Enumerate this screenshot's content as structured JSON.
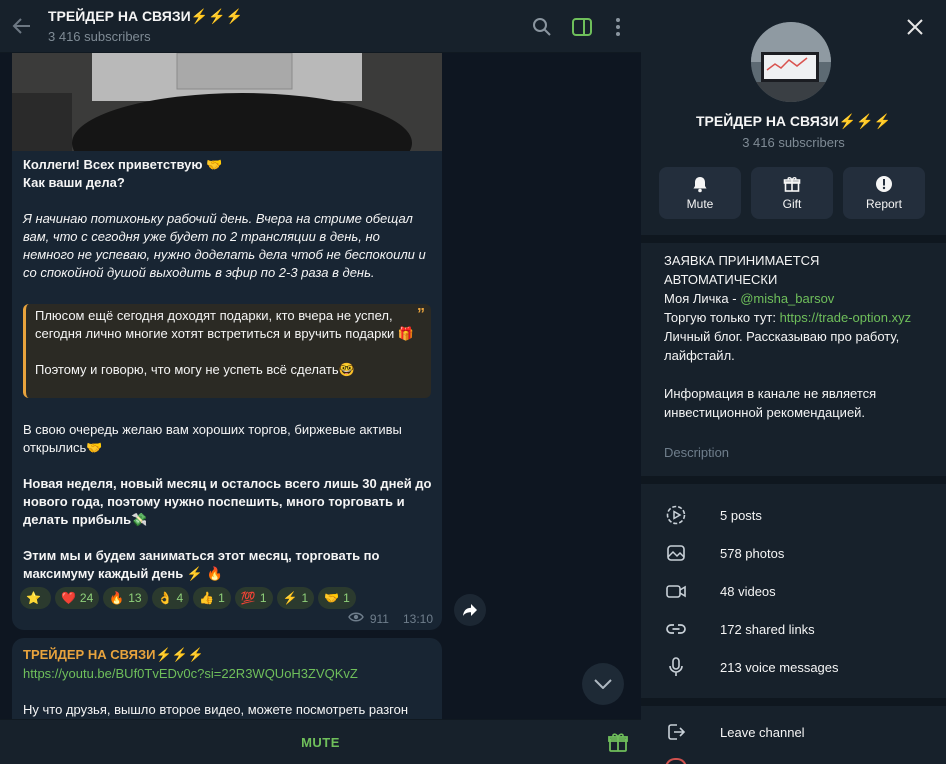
{
  "header": {
    "title": "ТРЕЙДЕР НА СВЯЗИ⚡️⚡️⚡️",
    "subscribers": "3 416 subscribers"
  },
  "message1": {
    "greeting": "Коллеги! Всех приветствую 🤝\nКак ваши дела?",
    "italic": "Я начинаю потихоньку рабочий день. Вчера на стриме обещал вам, что с сегодня уже будет по 2 трансляции в день, но немного не успеваю, нужно доделать дела чтоб не беспокоили и со спокойной душой выходить в эфир по 2-3 раза в день.",
    "quote": "Плюсом ещё сегодня доходят подарки, кто вчера не успел, сегодня лично многие хотят встретиться и вручить подарки 🎁\n\nПоэтому и говорю, что могу не успеть всё сделать🤓",
    "para1": "В свою очередь желаю вам хороших торгов, биржевые активы открылись🤝",
    "para2": "Новая неделя, новый месяц и осталось всего лишь 30 дней до нового года, поэтому нужно поспешить, много торговать и делать прибыль💸",
    "para3": "Этим мы и будем заниматься этот месяц, торговать по максимуму каждый день ⚡️ 🔥",
    "reactions": [
      {
        "emoji": "⭐",
        "count": ""
      },
      {
        "emoji": "❤️",
        "count": "24"
      },
      {
        "emoji": "🔥",
        "count": "13"
      },
      {
        "emoji": "👌",
        "count": "4"
      },
      {
        "emoji": "👍",
        "count": "1"
      },
      {
        "emoji": "💯",
        "count": "1"
      },
      {
        "emoji": "⚡",
        "count": "1"
      },
      {
        "emoji": "🤝",
        "count": "1"
      }
    ],
    "views": "911",
    "time": "13:10"
  },
  "message2": {
    "author": "ТРЕЙДЕР НА СВЯЗИ⚡️⚡️⚡️",
    "link": "https://youtu.be/BUf0TvEDv0c?si=22R3WQUoH3ZVQKvZ",
    "text": "Ну что друзья, вышло второе видео, можете посмотреть разгон"
  },
  "bottom": {
    "mute_label": "MUTE"
  },
  "panel": {
    "title": "ТРЕЙДЕР НА СВЯЗИ⚡️⚡️⚡️",
    "subscribers": "3 416 subscribers",
    "actions": {
      "mute": "Mute",
      "gift": "Gift",
      "report": "Report"
    },
    "desc_line1": "ЗАЯВКА ПРИНИМАЕТСЯ АВТОМАТИЧЕСКИ",
    "desc_line2_prefix": "Моя Личка - ",
    "desc_line2_link": "@misha_barsov",
    "desc_line3_prefix": "Торгую только тут: ",
    "desc_line3_link": "https://trade-option.xyz",
    "desc_line4": "Личный блог. Рассказываю про работу, лайфстайл.",
    "desc_line5": "Информация в канале не является инвестиционной рекомендацией.",
    "desc_label": "Description",
    "stats": {
      "posts": "5 posts",
      "photos": "578 photos",
      "videos": "48 videos",
      "links": "172 shared links",
      "voice": "213 voice messages"
    },
    "leave": "Leave channel"
  },
  "colors": {
    "accent": "#6fbf5b",
    "bubble": "#182533",
    "panel": "#17212b"
  }
}
